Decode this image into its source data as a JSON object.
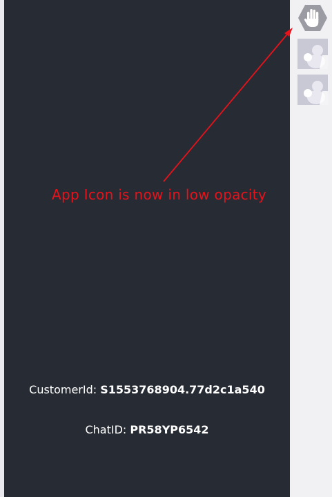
{
  "annotation": {
    "text": "App Icon is now in low opacity",
    "color": "#e8121b"
  },
  "info": {
    "customer_label": "CustomerId:",
    "customer_value": "S1553768904.77d2c1a540",
    "chat_label": "ChatID:",
    "chat_value": "PR58YP6542"
  },
  "right_rail": {
    "icons": [
      {
        "name": "hand-icon"
      },
      {
        "name": "avatar-thumbnail-icon"
      },
      {
        "name": "avatar-thumbnail-icon"
      }
    ]
  },
  "colors": {
    "panel_background": "#272b33",
    "rail_background": "#f1f1f4",
    "icon_gray": "#9b9ba3",
    "thumb_background": "#c9c8d5"
  }
}
